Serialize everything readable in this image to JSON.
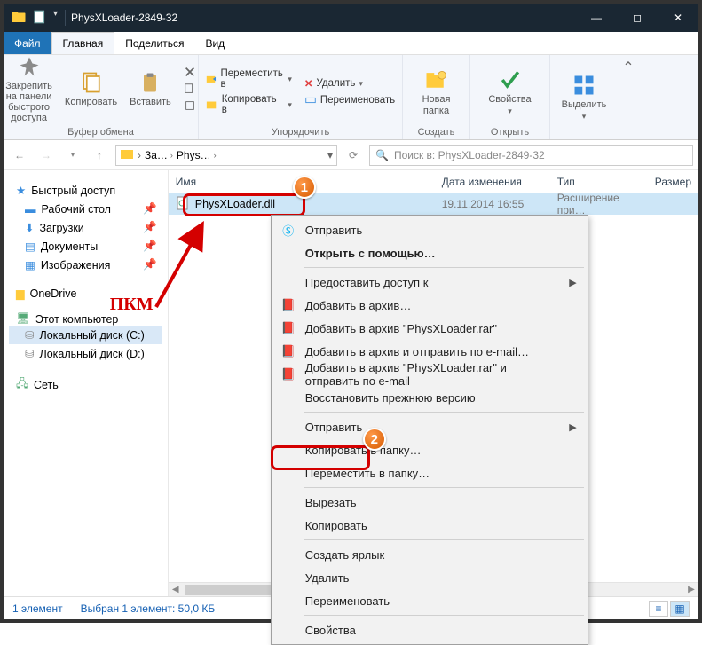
{
  "titlebar": {
    "title": "PhysXLoader-2849-32"
  },
  "menubar": {
    "file": "Файл",
    "home": "Главная",
    "share": "Поделиться",
    "view": "Вид"
  },
  "ribbon": {
    "clipboard": {
      "pin": "Закрепить на панели\nбыстрого доступа",
      "copy": "Копировать",
      "paste": "Вставить",
      "label": "Буфер обмена"
    },
    "organize": {
      "moveTo": "Переместить в",
      "copyTo": "Копировать в",
      "delete": "Удалить",
      "rename": "Переименовать",
      "label": "Упорядочить"
    },
    "new": {
      "newFolder": "Новая\nпапка",
      "label": "Создать"
    },
    "open": {
      "properties": "Свойства",
      "label": "Открыть"
    },
    "select": {
      "select": "Выделить",
      "label": ""
    }
  },
  "address": {
    "seg1": "За…",
    "seg2": "Phys…",
    "searchPlaceholder": "Поиск в: PhysXLoader-2849-32"
  },
  "nav": {
    "quick": "Быстрый доступ",
    "desktop": "Рабочий стол",
    "downloads": "Загрузки",
    "documents": "Документы",
    "pictures": "Изображения",
    "onedrive": "OneDrive",
    "thispc": "Этот компьютер",
    "driveC": "Локальный диск (C:)",
    "driveD": "Локальный диск (D:)",
    "network": "Сеть"
  },
  "columns": {
    "name": "Имя",
    "date": "Дата изменения",
    "type": "Тип",
    "size": "Размер"
  },
  "file": {
    "name": "PhysXLoader.dll",
    "date": "19.11.2014 16:55",
    "type": "Расширение при…"
  },
  "context": {
    "send": "Отправить",
    "openWith": "Открыть с помощью…",
    "grantAccess": "Предоставить доступ к",
    "addArchive": "Добавить в архив…",
    "addRar": "Добавить в архив \"PhysXLoader.rar\"",
    "emailArchive": "Добавить в архив и отправить по e-mail…",
    "emailRar": "Добавить в архив \"PhysXLoader.rar\" и отправить по e-mail",
    "restore": "Восстановить прежнюю версию",
    "sendTo": "Отправить",
    "copyToFolder": "Копировать в папку…",
    "moveToFolder": "Переместить в папку…",
    "cut": "Вырезать",
    "copy": "Копировать",
    "shortcut": "Создать ярлык",
    "delete": "Удалить",
    "rename": "Переименовать",
    "properties": "Свойства"
  },
  "annotation": {
    "pkm": "ПКМ",
    "badge1": "1",
    "badge2": "2"
  },
  "status": {
    "count": "1 элемент",
    "selected": "Выбран 1 элемент: 50,0 КБ"
  }
}
